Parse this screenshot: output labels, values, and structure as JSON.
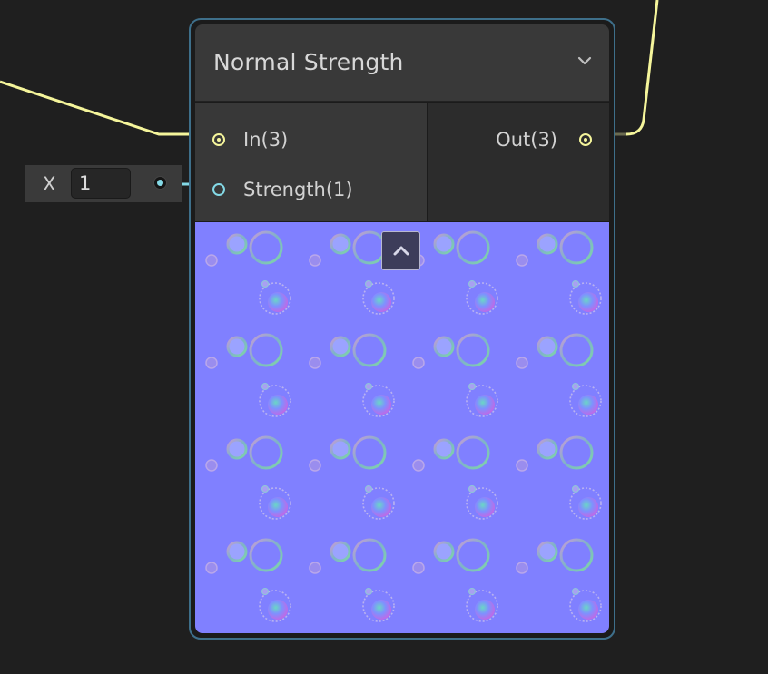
{
  "node": {
    "title": "Normal Strength",
    "inputs": [
      {
        "label": "In(3)",
        "type": "Vector 3"
      },
      {
        "label": "Strength(1)",
        "type": "Float"
      }
    ],
    "outputs": [
      {
        "label": "Out(3)",
        "type": "Vector 3"
      }
    ],
    "preview_color": "#8080ff"
  },
  "inline_input": {
    "axis": "X",
    "value": "1"
  },
  "colors": {
    "background": "#1f1f1f",
    "node_border_selected": "#3e6f8a",
    "vector3_port": "#f5f59b",
    "float_port": "#84d9e6"
  },
  "icons": {
    "collapse": "chevron-down-icon",
    "preview_toggle": "chevron-up-icon"
  }
}
